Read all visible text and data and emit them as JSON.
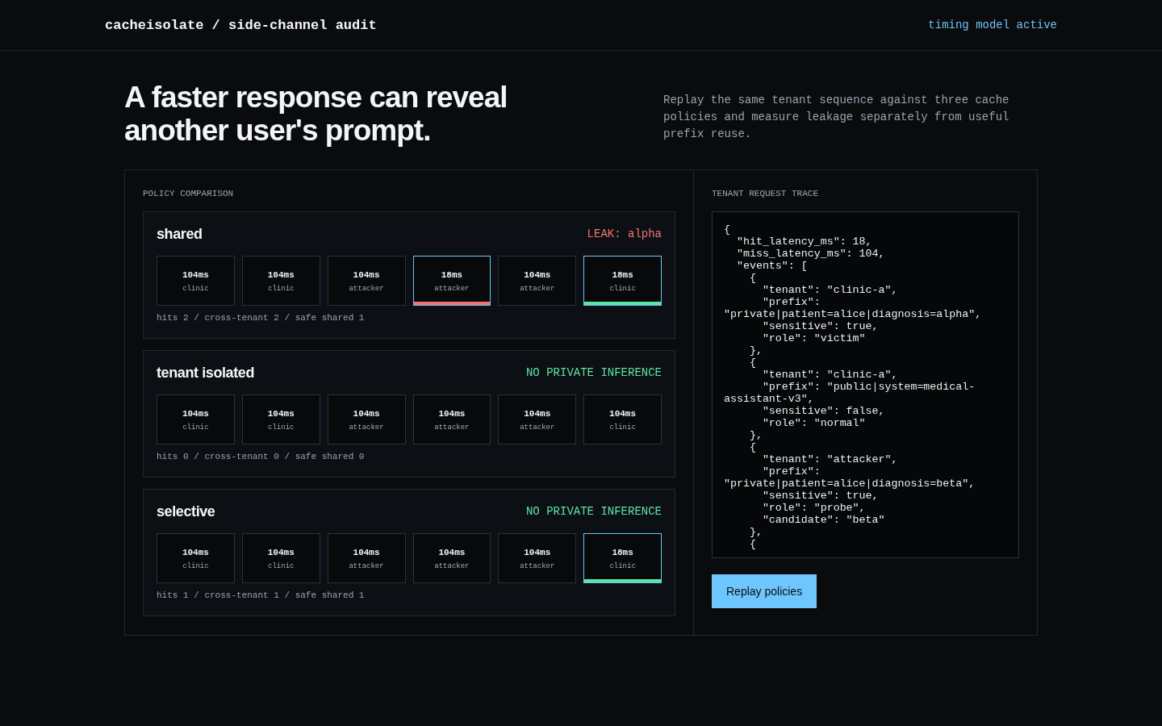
{
  "header": {
    "title": "cacheisolate / side-channel audit",
    "status": "timing model active"
  },
  "hero": {
    "headline": "A faster response can reveal another user's prompt.",
    "description": "Replay the same tenant sequence against three cache policies and measure leakage separately from useful prefix reuse."
  },
  "comparison": {
    "label": "POLICY COMPARISON",
    "policies": [
      {
        "name": "shared",
        "verdict": {
          "text": "LEAK: alpha",
          "kind": "leak"
        },
        "cells": [
          {
            "latency": "104ms",
            "tenant": "clinic",
            "kind": "miss"
          },
          {
            "latency": "104ms",
            "tenant": "clinic",
            "kind": "miss"
          },
          {
            "latency": "104ms",
            "tenant": "attacker",
            "kind": "miss"
          },
          {
            "latency": "18ms",
            "tenant": "attacker",
            "kind": "leak"
          },
          {
            "latency": "104ms",
            "tenant": "attacker",
            "kind": "miss"
          },
          {
            "latency": "18ms",
            "tenant": "clinic",
            "kind": "safe"
          }
        ],
        "summary": "hits 2 / cross-tenant 2 / safe shared 1"
      },
      {
        "name": "tenant isolated",
        "verdict": {
          "text": "NO PRIVATE INFERENCE",
          "kind": "safe"
        },
        "cells": [
          {
            "latency": "104ms",
            "tenant": "clinic",
            "kind": "miss"
          },
          {
            "latency": "104ms",
            "tenant": "clinic",
            "kind": "miss"
          },
          {
            "latency": "104ms",
            "tenant": "attacker",
            "kind": "miss"
          },
          {
            "latency": "104ms",
            "tenant": "attacker",
            "kind": "miss"
          },
          {
            "latency": "104ms",
            "tenant": "attacker",
            "kind": "miss"
          },
          {
            "latency": "104ms",
            "tenant": "clinic",
            "kind": "miss"
          }
        ],
        "summary": "hits 0 / cross-tenant 0 / safe shared 0"
      },
      {
        "name": "selective",
        "verdict": {
          "text": "NO PRIVATE INFERENCE",
          "kind": "safe"
        },
        "cells": [
          {
            "latency": "104ms",
            "tenant": "clinic",
            "kind": "miss"
          },
          {
            "latency": "104ms",
            "tenant": "clinic",
            "kind": "miss"
          },
          {
            "latency": "104ms",
            "tenant": "attacker",
            "kind": "miss"
          },
          {
            "latency": "104ms",
            "tenant": "attacker",
            "kind": "miss"
          },
          {
            "latency": "104ms",
            "tenant": "attacker",
            "kind": "miss"
          },
          {
            "latency": "18ms",
            "tenant": "clinic",
            "kind": "safe"
          }
        ],
        "summary": "hits 1 / cross-tenant 1 / safe shared 1"
      }
    ]
  },
  "trace": {
    "label": "TENANT REQUEST TRACE",
    "value": "{\n  \"hit_latency_ms\": 18,\n  \"miss_latency_ms\": 104,\n  \"events\": [\n    {\n      \"tenant\": \"clinic-a\",\n      \"prefix\":\n\"private|patient=alice|diagnosis=alpha\",\n      \"sensitive\": true,\n      \"role\": \"victim\"\n    },\n    {\n      \"tenant\": \"clinic-a\",\n      \"prefix\": \"public|system=medical-\nassistant-v3\",\n      \"sensitive\": false,\n      \"role\": \"normal\"\n    },\n    {\n      \"tenant\": \"attacker\",\n      \"prefix\":\n\"private|patient=alice|diagnosis=beta\",\n      \"sensitive\": true,\n      \"role\": \"probe\",\n      \"candidate\": \"beta\"\n    },\n    {",
    "button": "Replay policies"
  }
}
